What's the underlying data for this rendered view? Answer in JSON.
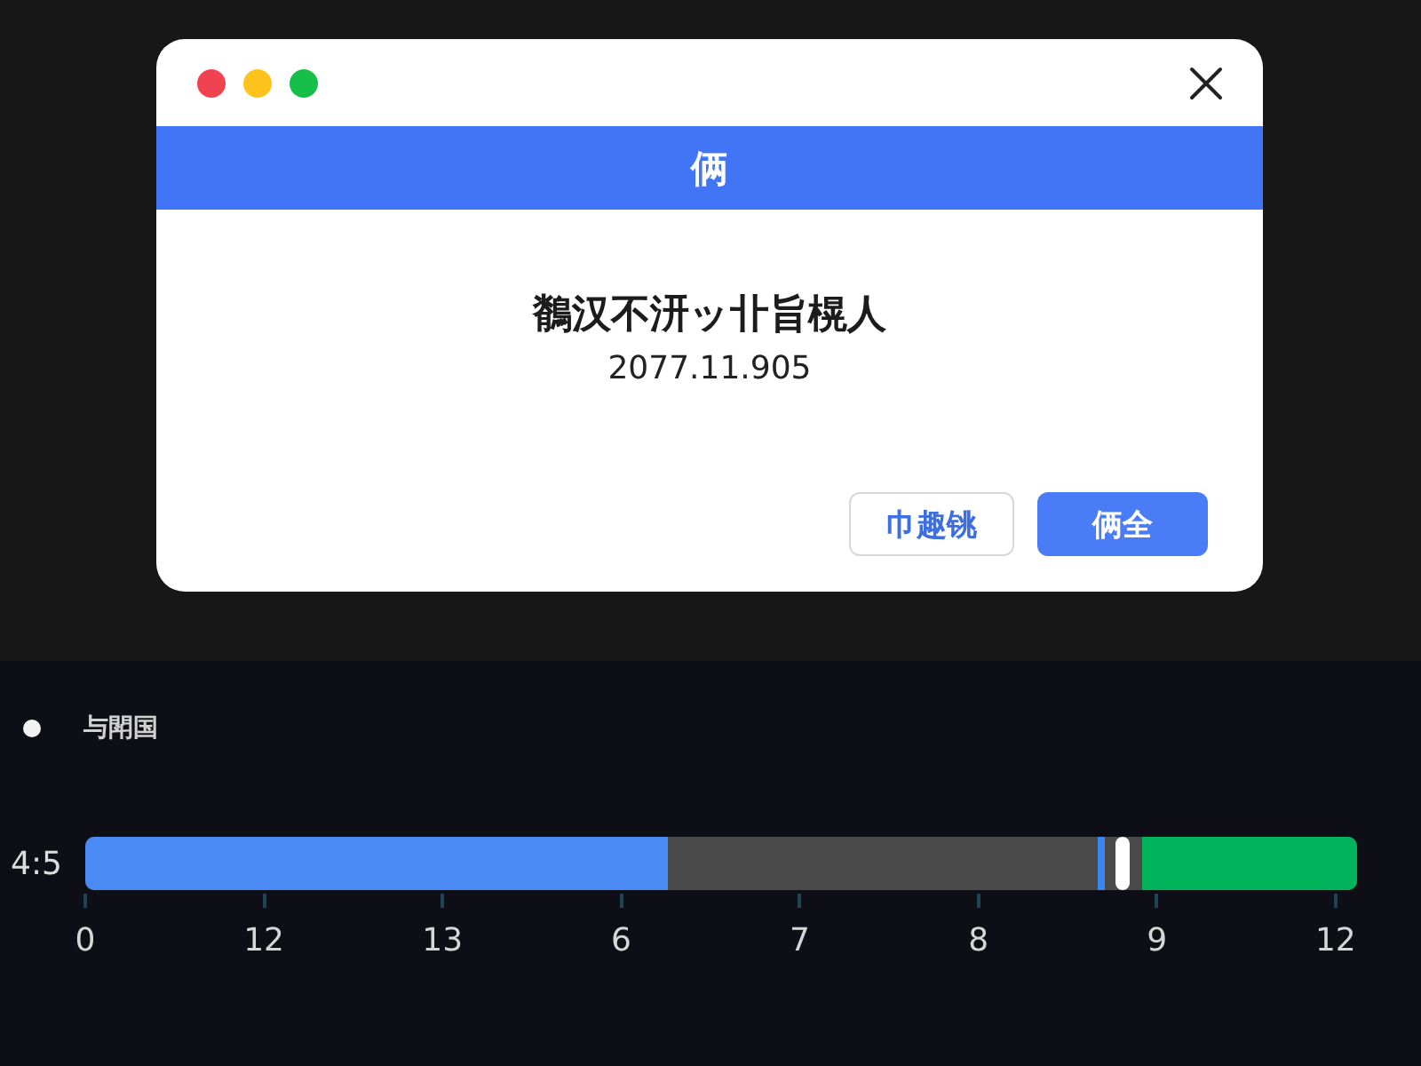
{
  "dialog": {
    "window_controls": [
      {
        "kind": "close"
      },
      {
        "kind": "minimize"
      },
      {
        "kind": "zoom"
      }
    ],
    "title": "俩",
    "message": "鶺汉不汧ッ卝旨榥人",
    "date": "2077.11.905",
    "buttons": [
      {
        "label": "巾趣铫",
        "kind": "secondary"
      },
      {
        "label": "俩全",
        "kind": "primary"
      }
    ]
  },
  "timeline": {
    "legend": "与閗国",
    "row_label": "4:5",
    "played": {
      "level": 0.458
    },
    "marker": {
      "level": 0.799
    },
    "handle": {
      "level": 0.816
    },
    "tail": {
      "level": 0.169
    },
    "ticks": [
      "0",
      "12",
      "13",
      "6",
      "7",
      "8",
      "9",
      "12"
    ]
  }
}
